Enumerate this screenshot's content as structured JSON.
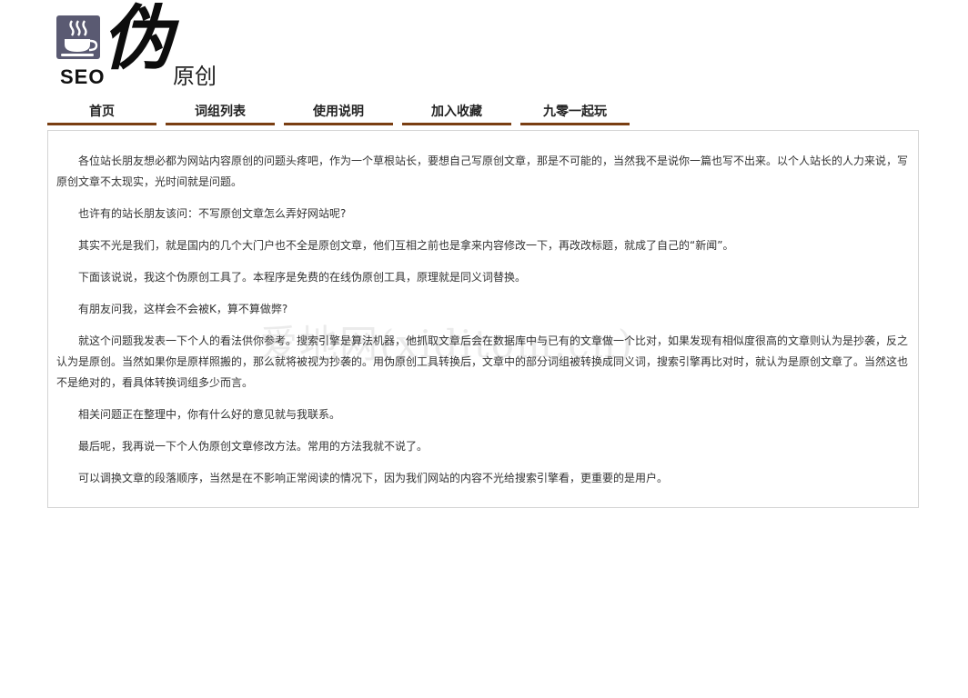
{
  "logo": {
    "seo": "SEO",
    "wei": "伪",
    "yuanchuang": "原创"
  },
  "nav": {
    "items": [
      {
        "label": "首页"
      },
      {
        "label": "词组列表"
      },
      {
        "label": "使用说明"
      },
      {
        "label": "加入收藏"
      },
      {
        "label": "九零一起玩"
      }
    ],
    "underline_color": "#7a3e12"
  },
  "content": {
    "paragraphs": [
      "各位站长朋友想必都为网站内容原创的问题头疼吧，作为一个草根站长，要想自己写原创文章，那是不可能的，当然我不是说你一篇也写不出来。以个人站长的人力来说，写原创文章不太现实，光时间就是问题。",
      "也许有的站长朋友该问：不写原创文章怎么弄好网站呢?",
      "其实不光是我们，就是国内的几个大门户也不全是原创文章，他们互相之前也是拿来内容修改一下，再改改标题，就成了自己的“新闻”。",
      "下面该说说，我这个伪原创工具了。本程序是免费的在线伪原创工具，原理就是同义词替换。",
      "有朋友问我，这样会不会被K，算不算做弊?",
      "就这个问题我发表一下个人的看法供你参考。搜索引擎是算法机器，他抓取文章后会在数据库中与已有的文章做一个比对，如果发现有相似度很高的文章则认为是抄袭，反之认为是原创。当然如果你是原样照搬的，那么就将被视为抄袭的。用伪原创工具转换后，文章中的部分词组被转换成同义词，搜索引擎再比对时，就认为是原创文章了。当然这也不是绝对的，看具体转换词组多少而言。",
      "相关问题正在整理中，你有什么好的意见就与我联系。",
      "最后呢，我再说一下个人伪原创文章修改方法。常用的方法我就不说了。",
      "可以调换文章的段落顺序，当然是在不影响正常阅读的情况下，因为我们网站的内容不光给搜索引擎看，更重要的是用户。"
    ]
  },
  "watermark": "爱地网(xiditom.cn)"
}
